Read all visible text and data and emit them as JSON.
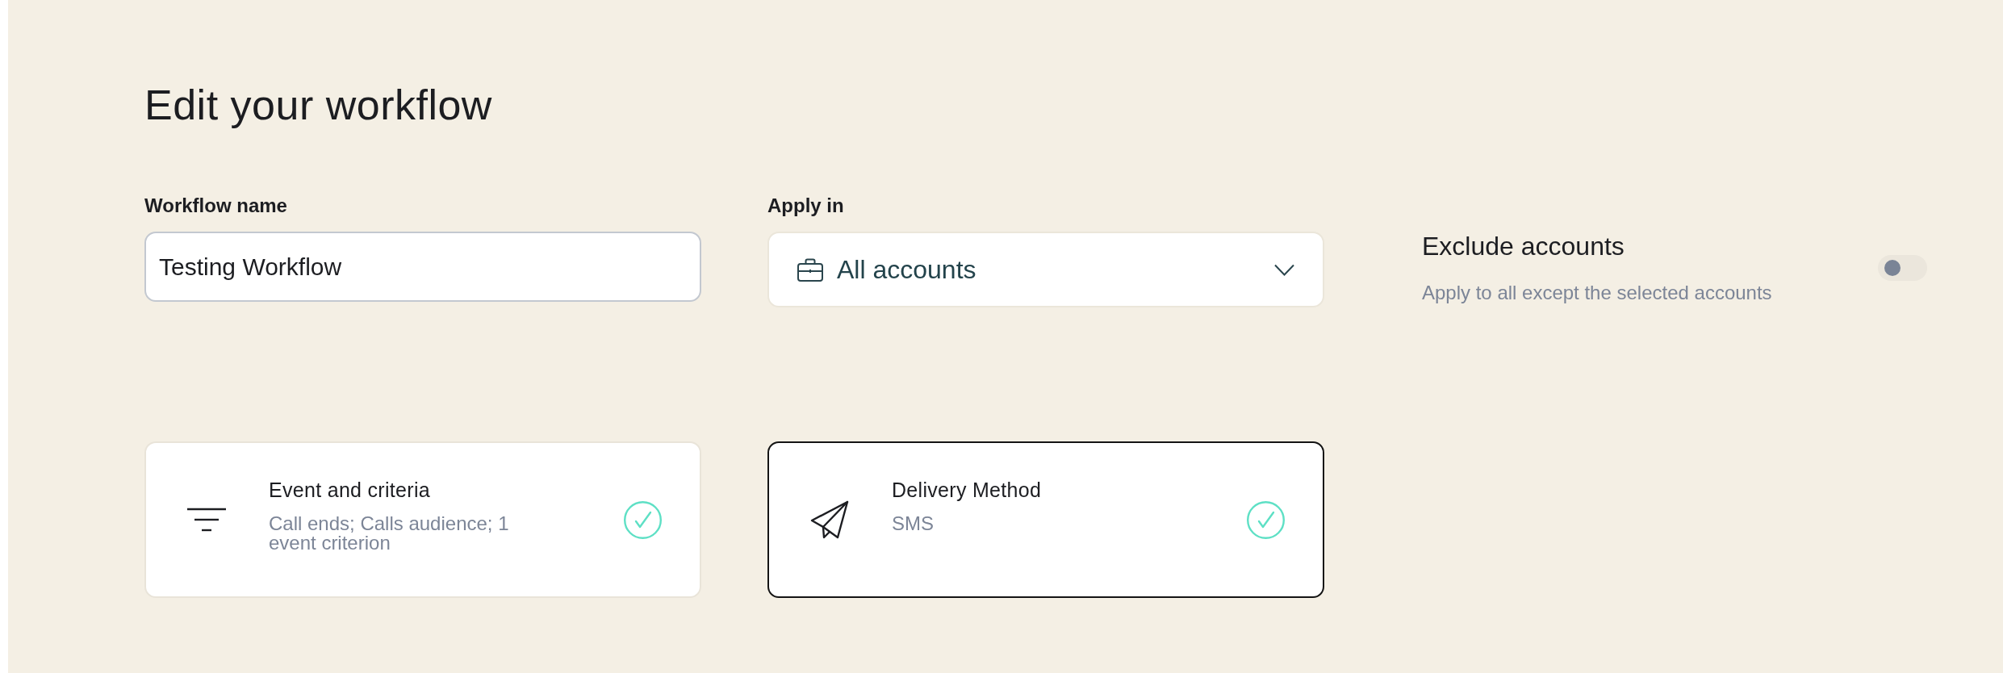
{
  "title": "Edit your workflow",
  "fields": [
    {
      "kind": "text",
      "label": "Workflow name",
      "value": "Testing Workflow"
    },
    {
      "kind": "select",
      "label": "Apply in",
      "value": "All accounts"
    }
  ],
  "exclude_accounts": {
    "title": "Exclude accounts",
    "description": "Apply to all except the selected accounts",
    "on": false
  },
  "steps": [
    {
      "kind": "filter",
      "title": "Event and criteria",
      "summary": "Call ends; Calls audience; 1 event criterion",
      "selected": false,
      "complete": true
    },
    {
      "kind": "send",
      "title": "Delivery Method",
      "summary": "SMS",
      "selected": true,
      "complete": true
    }
  ]
}
